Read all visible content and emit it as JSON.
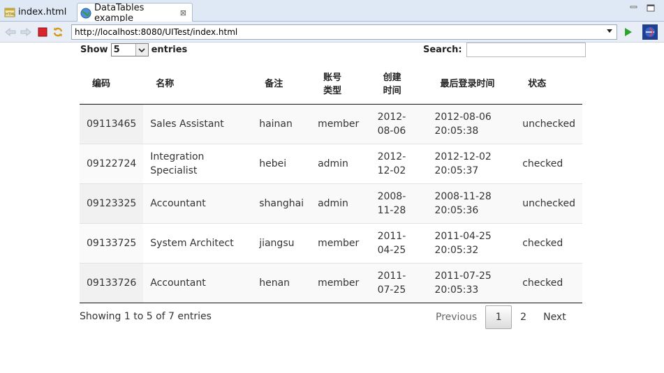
{
  "tabs": [
    {
      "label": "index.html",
      "icon": "html-file-icon",
      "active": false
    },
    {
      "label": "DataTables example",
      "icon": "globe-icon",
      "active": true
    }
  ],
  "tab_close_glyph": "⊠",
  "browser": {
    "url": "http://localhost:8080/UITest/index.html"
  },
  "datatable": {
    "length": {
      "prefix": "Show",
      "value": "5",
      "suffix": "entries"
    },
    "search": {
      "label": "Search:",
      "value": ""
    },
    "columns": [
      "编码",
      "名称",
      "备注",
      "账号类型",
      "创建时间",
      "最后登录时间",
      "状态"
    ],
    "rows": [
      [
        "09113465",
        "Sales Assistant",
        "hainan",
        "member",
        "2012-08-06",
        "2012-08-06 20:05:38",
        "unchecked"
      ],
      [
        "09122724",
        "Integration Specialist",
        "hebei",
        "admin",
        "2012-12-02",
        "2012-12-02 20:05:37",
        "checked"
      ],
      [
        "09123325",
        "Accountant",
        "shanghai",
        "admin",
        "2008-11-28",
        "2008-11-28 20:05:36",
        "unchecked"
      ],
      [
        "09133725",
        "System Architect",
        "jiangsu",
        "member",
        "2011-04-25",
        "2011-04-25 20:05:32",
        "checked"
      ],
      [
        "09133726",
        "Accountant",
        "henan",
        "member",
        "2011-07-25",
        "2011-07-25 20:05:33",
        "checked"
      ]
    ],
    "info": "Showing 1 to 5 of 7 entries",
    "pagination": {
      "previous": "Previous",
      "pages": [
        "1",
        "2"
      ],
      "current": "1",
      "next": "Next"
    }
  },
  "colors": {
    "accent": "#2a6ebb",
    "stop": "#d9262c",
    "go": "#2aa52a"
  }
}
